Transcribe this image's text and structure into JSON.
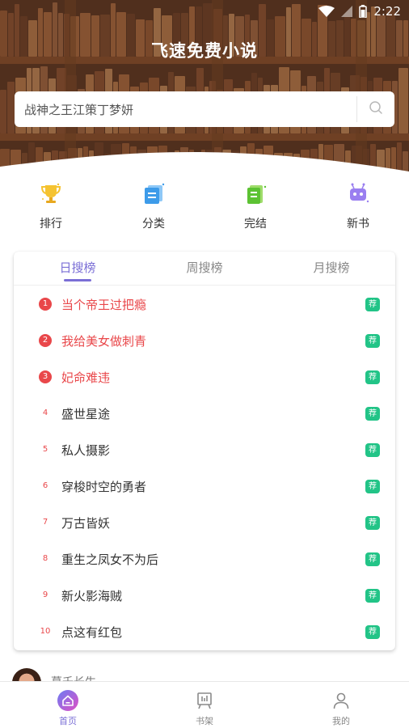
{
  "status_bar": {
    "time": "2:22"
  },
  "header": {
    "title": "飞速免费小说"
  },
  "search": {
    "value": "战神之王江策丁梦妍"
  },
  "quick_links": [
    {
      "label": "排行",
      "icon": "trophy-icon"
    },
    {
      "label": "分类",
      "icon": "category-icon"
    },
    {
      "label": "完结",
      "icon": "finished-book-icon"
    },
    {
      "label": "新书",
      "icon": "new-book-robot-icon"
    }
  ],
  "ranking": {
    "tabs": [
      {
        "label": "日搜榜",
        "active": true
      },
      {
        "label": "周搜榜",
        "active": false
      },
      {
        "label": "月搜榜",
        "active": false
      }
    ],
    "recommend_badge": "荐",
    "items": [
      {
        "rank": "1",
        "title": "当个帝王过把瘾"
      },
      {
        "rank": "2",
        "title": "我给美女做刺青"
      },
      {
        "rank": "3",
        "title": "妃命难违"
      },
      {
        "rank": "4",
        "title": "盛世星途"
      },
      {
        "rank": "5",
        "title": "私人摄影"
      },
      {
        "rank": "6",
        "title": "穿梭时空的勇者"
      },
      {
        "rank": "7",
        "title": "万古皆妖"
      },
      {
        "rank": "8",
        "title": "重生之凤女不为后"
      },
      {
        "rank": "9",
        "title": "新火影海贼"
      },
      {
        "rank": "10",
        "title": "点这有红包"
      }
    ]
  },
  "peek": {
    "text": "慕千长生"
  },
  "bottom_nav": [
    {
      "label": "首页",
      "icon": "home-icon",
      "active": true
    },
    {
      "label": "书架",
      "icon": "bookshelf-icon",
      "active": false
    },
    {
      "label": "我的",
      "icon": "profile-icon",
      "active": false
    }
  ],
  "colors": {
    "accent": "#7b6fd6",
    "hot": "#e9474a",
    "badge": "#22c487"
  }
}
